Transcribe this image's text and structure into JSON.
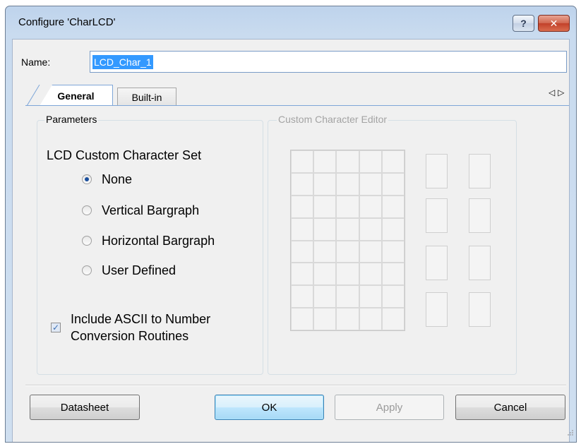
{
  "window": {
    "title": "Configure 'CharLCD'",
    "help_glyph": "?",
    "close_glyph": "✕"
  },
  "name_field": {
    "label": "Name:",
    "value": "LCD_Char_1"
  },
  "tabs": [
    {
      "label": "General",
      "active": true
    },
    {
      "label": "Built-in",
      "active": false
    }
  ],
  "tab_scroll": {
    "left_icon": "◁",
    "right_icon": "▷"
  },
  "parameters": {
    "group_title": "Parameters",
    "set_label": "LCD Custom Character Set",
    "options": [
      {
        "label": "None",
        "checked": true
      },
      {
        "label": "Vertical Bargraph",
        "checked": false
      },
      {
        "label": "Horizontal Bargraph",
        "checked": false
      },
      {
        "label": "User Defined",
        "checked": false
      }
    ],
    "include_ascii": {
      "line1": "Include ASCII to Number",
      "line2": "Conversion Routines",
      "checked": true,
      "check_glyph": "✓"
    }
  },
  "editor": {
    "group_title": "Custom Character Editor",
    "enabled": false
  },
  "buttons": {
    "datasheet": "Datasheet",
    "ok": "OK",
    "apply": "Apply",
    "cancel": "Cancel"
  },
  "colors": {
    "selection": "#3399ff",
    "tab_accent": "#7ea6d8"
  }
}
